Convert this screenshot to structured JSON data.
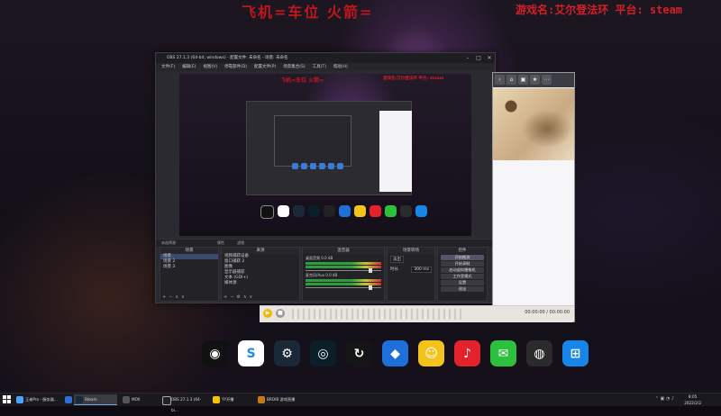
{
  "overlay": {
    "red_text": "飞机=车位 火箭=",
    "game_text": "游戏名:艾尔登法环 平台: steam"
  },
  "obs": {
    "title": "OBS 27.1.3 (64-bit, windows) - 配置文件: 未命名 - 场景: 未命名",
    "menu": [
      "文件(F)",
      "编辑(E)",
      "视图(V)",
      "停靠部件(D)",
      "配置文件(P)",
      "场景集合(S)",
      "工具(T)",
      "帮助(H)"
    ],
    "preview": {
      "red_text": "飞机=车位 火箭=",
      "game_text": "游戏名:艾尔登法环 平台: steam"
    },
    "status_bar": {
      "left": "未选择源",
      "mid": "属性",
      "right": "滤镜"
    },
    "docks": {
      "scenes": {
        "title": "场景",
        "items": [
          "场景",
          "场景 2",
          "场景 3"
        ]
      },
      "sources": {
        "title": "来源",
        "items": [
          "视频捕获设备",
          "窗口捕获 2",
          "图像",
          "显示器捕获",
          "文本 (GDI+)",
          "媒体源"
        ]
      },
      "mixer": {
        "title": "混音器",
        "tracks": [
          {
            "name": "桌面音频",
            "level": "0.0 dB"
          },
          {
            "name": "麦克风/Aux",
            "level": "0.0 dB"
          }
        ]
      },
      "transitions": {
        "title": "场景转场",
        "type_label": "淡出",
        "duration_label": "时长",
        "duration": "300 ms"
      },
      "controls": {
        "title": "控件",
        "buttons": [
          "开始推流",
          "开始录制",
          "启动虚拟摄像机",
          "工作室模式",
          "设置",
          "退出"
        ]
      }
    }
  },
  "player": {
    "status": "00:00:00 / 00:00:00"
  },
  "taskbar": {
    "items": [
      "王者Pro - 服务器...",
      "Steam",
      "MOX",
      "OBS 27.1.3 (64-bi...",
      "YY开播",
      "BROIB 游戏直播"
    ],
    "time": "8:05",
    "date": "2022/2/2"
  },
  "dock_icons": [
    {
      "name": "obs-studio-icon",
      "color": "#111111",
      "glyph": "◉"
    },
    {
      "name": "sogou-icon",
      "color": "#ffffff",
      "glyph": "S"
    },
    {
      "name": "steam-icon",
      "color": "#1b2838",
      "glyph": "⚙"
    },
    {
      "name": "app-circle-icon",
      "color": "#0b1f2a",
      "glyph": "◎"
    },
    {
      "name": "update-icon",
      "color": "#151515",
      "glyph": "↻"
    },
    {
      "name": "cube-app-icon",
      "color": "#1e6fd9",
      "glyph": "◆"
    },
    {
      "name": "qq-pet-icon",
      "color": "#f3c21b",
      "glyph": "☺"
    },
    {
      "name": "netease-music-icon",
      "color": "#e3222b",
      "glyph": "♪"
    },
    {
      "name": "wechat-icon",
      "color": "#2dbf3e",
      "glyph": "✉"
    },
    {
      "name": "camera-icon",
      "color": "#2b2b2b",
      "glyph": "◍"
    },
    {
      "name": "windows-icon",
      "color": "#1687e8",
      "glyph": "⊞"
    }
  ]
}
